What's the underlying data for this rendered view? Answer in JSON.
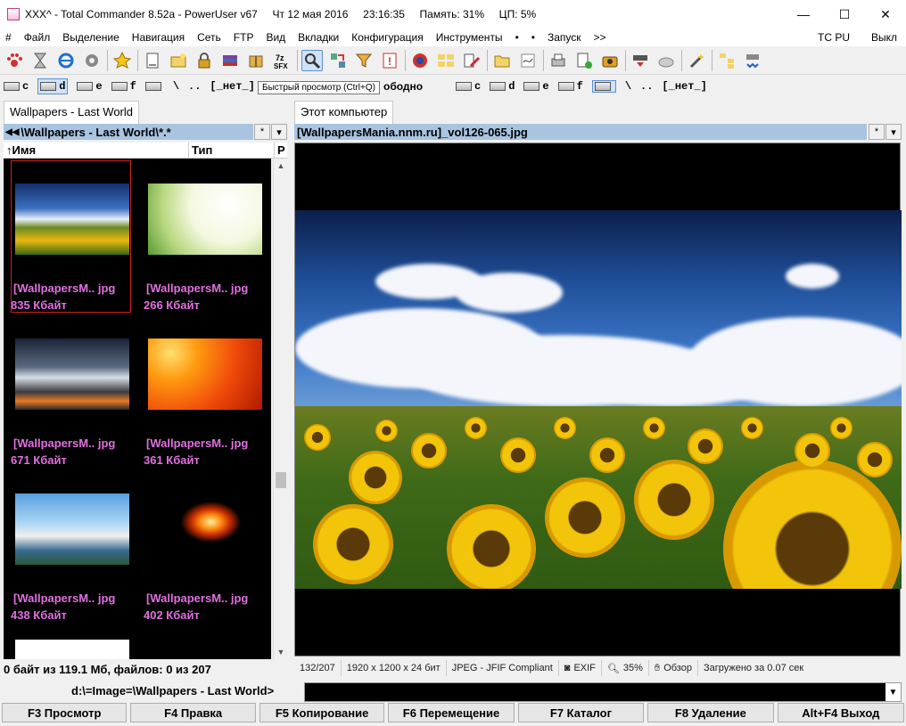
{
  "window": {
    "title": "XXX^ - Total Commander 8.52a - PowerUser v67     Чт 12 мая 2016     23:16:35     Память: 31%     ЦП: 5%",
    "minimize": "—",
    "maximize": "☐",
    "close": "✕"
  },
  "menu": {
    "items": [
      "#",
      "Файл",
      "Выделение",
      "Навигация",
      "Сеть",
      "FTP",
      "Вид",
      "Вкладки",
      "Конфигурация",
      "Инструменты",
      "•",
      "•",
      "Запуск",
      ">>"
    ],
    "right": [
      "TC PU",
      "Выкл"
    ]
  },
  "toolbar": {
    "icons": [
      "paw-icon",
      "hourglass-icon",
      "internet-explorer-icon",
      "gear-icon",
      "star-icon",
      "new-document-icon",
      "new-folder-icon",
      "lock-icon",
      "archive-icon",
      "package-icon",
      "sfx-archive-icon",
      "quick-view-icon",
      "sync-icon",
      "filter-icon",
      "info-icon",
      "disk-icon",
      "compare-icon",
      "rename-icon",
      "folder-icon",
      "notepad-icon",
      "print-icon",
      "add-icon",
      "camera-icon",
      "download-icon",
      "drive-icon",
      "wand-icon",
      "tree-icon",
      "network-icon"
    ],
    "sfx_label": "7z SFX",
    "info_label": "!"
  },
  "left_drives": {
    "drives": [
      "c",
      "d",
      "e",
      "f",
      "\\",
      ".."
    ],
    "free": "[_нет_]",
    "free_tail": "ободно"
  },
  "right_drives": {
    "drives": [
      "c",
      "d",
      "e",
      "f",
      "\\",
      ".."
    ],
    "free": "[_нет_]"
  },
  "tooltip": "Быстрый просмотр (Ctrl+Q)",
  "left_panel": {
    "tab": "Wallpapers - Last World",
    "path": "\\Wallpapers - Last World\\*.*",
    "path_star": "*",
    "path_dropdown": "▾",
    "columns": [
      "Имя",
      "Тип",
      "Р"
    ],
    "files": [
      {
        "name": "[WallpapersM.. jpg",
        "size": "835 Кбайт",
        "thumb": "sunflower-field"
      },
      {
        "name": "[WallpapersM.. jpg",
        "size": "266 Кбайт",
        "thumb": "green-plants-white"
      },
      {
        "name": "[WallpapersM.. jpg",
        "size": "671 Кбайт",
        "thumb": "snowy-mountain-night"
      },
      {
        "name": "[WallpapersM.. jpg",
        "size": "361 Кбайт",
        "thumb": "orange-gerbera"
      },
      {
        "name": "[WallpapersM.. jpg",
        "size": "438 Кбайт",
        "thumb": "girl-car-palms"
      },
      {
        "name": "[WallpapersM.. jpg",
        "size": "402 Кбайт",
        "thumb": "fire-figure"
      }
    ],
    "status": "0 байт из 119.1 Мб, файлов: 0 из 207"
  },
  "right_panel": {
    "tab": "Этот компьютер",
    "path": "[WallpapersMania.nnm.ru]_vol126-065.jpg",
    "path_star": "*",
    "path_dropdown": "▾",
    "status": {
      "index": "132/207",
      "dimensions": "1920 x 1200 x 24 бит",
      "format": "JPEG - JFIF Compliant",
      "exif": "EXIF",
      "zoom": "35%",
      "overview": "Обзор",
      "loaded": "Загружено за 0.07 сек"
    }
  },
  "command": {
    "path": "d:\\=Image=\\Wallpapers - Last World>",
    "value": ""
  },
  "fkeys": [
    "F3 Просмотр",
    "F4 Правка",
    "F5 Копирование",
    "F6 Перемещение",
    "F7 Каталог",
    "F8 Удаление",
    "Alt+F4 Выход"
  ]
}
